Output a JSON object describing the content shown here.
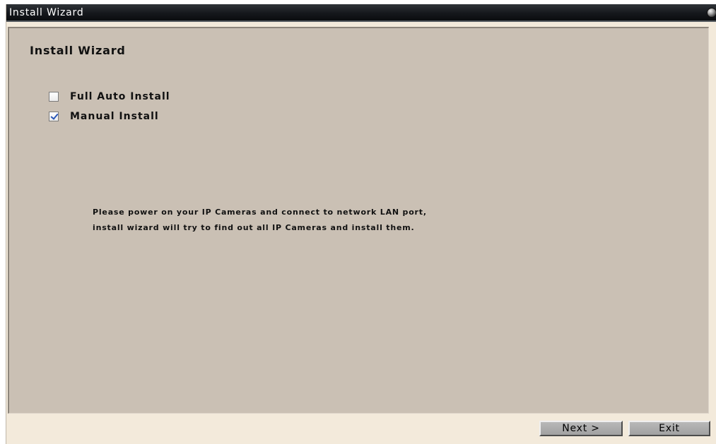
{
  "window": {
    "title": "Install Wizard"
  },
  "panel": {
    "heading": "Install Wizard",
    "options": [
      {
        "label": "Full Auto Install",
        "checked": false
      },
      {
        "label": "Manual Install",
        "checked": true
      }
    ],
    "message_lines": [
      "Please power on your IP Cameras and connect to network LAN port,",
      "install wizard will try to find out all IP Cameras and install them."
    ]
  },
  "footer": {
    "next_label": "Next >",
    "exit_label": "Exit"
  },
  "colors": {
    "titlebar": "#15181c",
    "panel_background": "#cac0b4",
    "window_background": "#f3eadb",
    "check_mark": "#2a57b8"
  },
  "icons": {
    "title_orb": "orb-icon",
    "check": "checkmark-icon"
  }
}
